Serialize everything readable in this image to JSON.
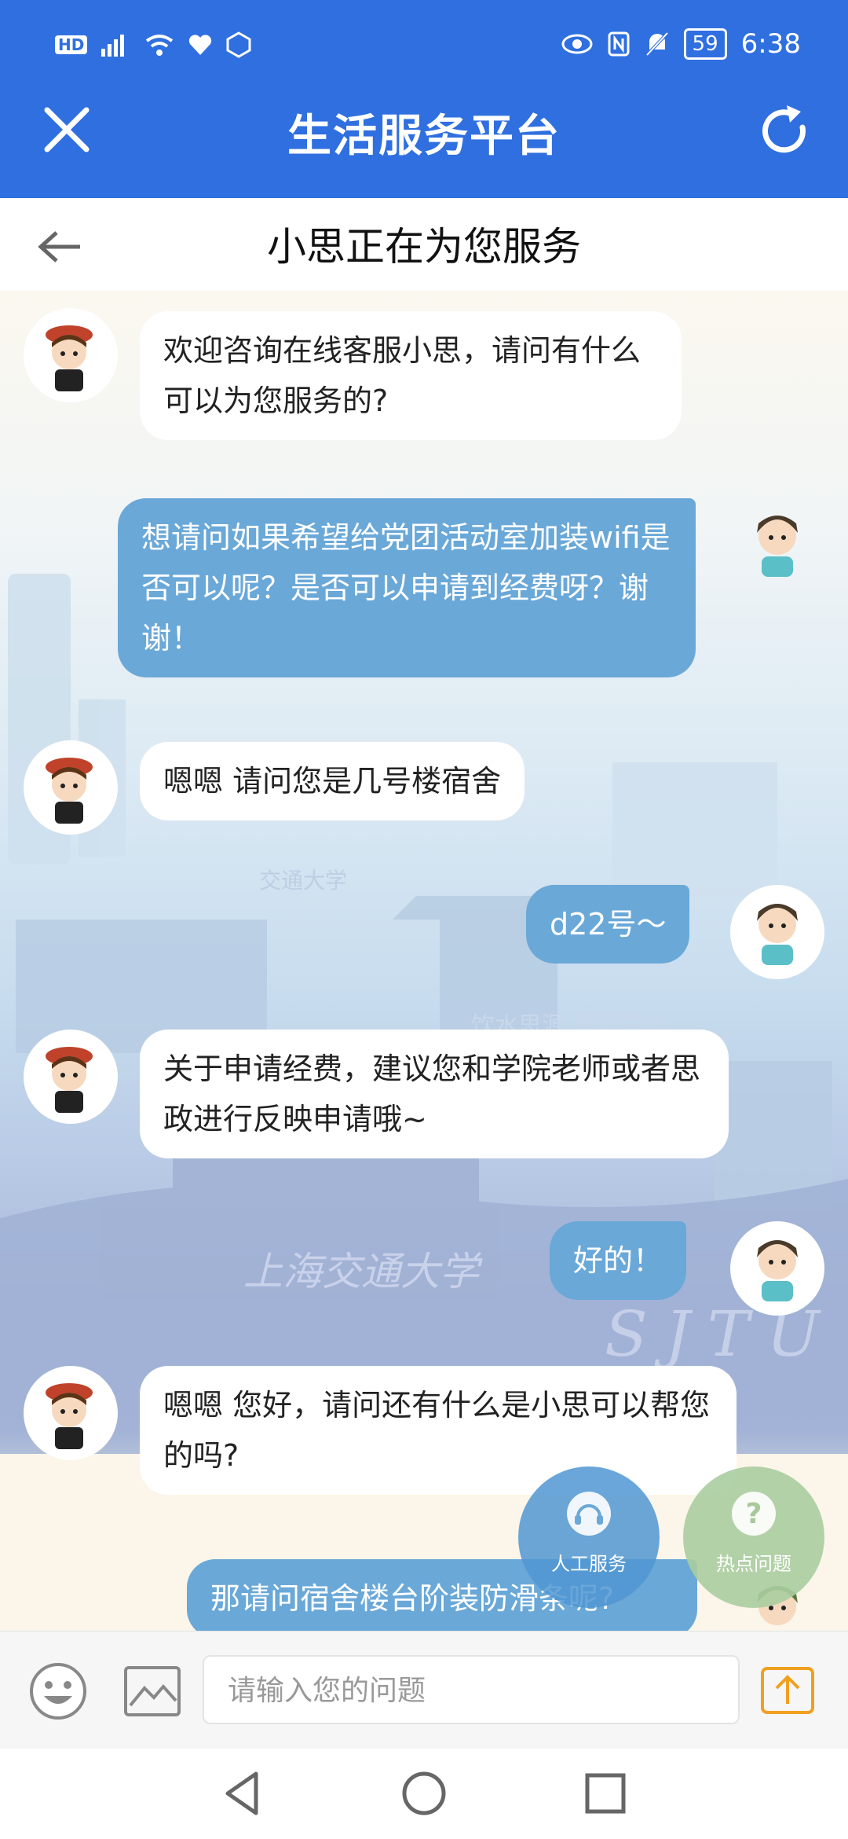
{
  "status_bar": {
    "left_label": "HD",
    "battery": "59",
    "time": "6:38"
  },
  "header": {
    "title": "生活服务平台",
    "close_icon": "close-icon",
    "refresh_icon": "refresh-icon"
  },
  "subheader": {
    "title": "小思正在为您服务",
    "back_icon": "back-arrow-icon"
  },
  "messages": [
    {
      "from": "bot",
      "text": "欢迎咨询在线客服小思，请问有什么可以为您服务的?"
    },
    {
      "from": "user",
      "text": "想请问如果希望给党团活动室加装wifi是否可以呢？是否可以申请到经费呀？谢谢！"
    },
    {
      "from": "bot",
      "text": "嗯嗯 请问您是几号楼宿舍"
    },
    {
      "from": "user",
      "text": "d22号～"
    },
    {
      "from": "bot",
      "text": "关于申请经费，建议您和学院老师或者思政进行反映申请哦~"
    },
    {
      "from": "user",
      "text": "好的！"
    },
    {
      "from": "bot",
      "text": "嗯嗯  您好，请问还有什么是小思可以帮您的吗?"
    },
    {
      "from": "user",
      "text": "那请问宿舍楼台阶装防滑条呢?"
    }
  ],
  "fab": {
    "human_service": "人工服务",
    "hot_questions": "热点问题"
  },
  "watermark": {
    "school_cn": "上海交通大学",
    "school_en": "SJTU",
    "motto": "饮水思源 爱国荣校",
    "seal": "交通大学"
  },
  "input": {
    "placeholder": "请输入您的问题"
  },
  "colors": {
    "primary": "#2f6fe0",
    "user_bubble": "#6aa8d8",
    "send": "#f0a020"
  }
}
